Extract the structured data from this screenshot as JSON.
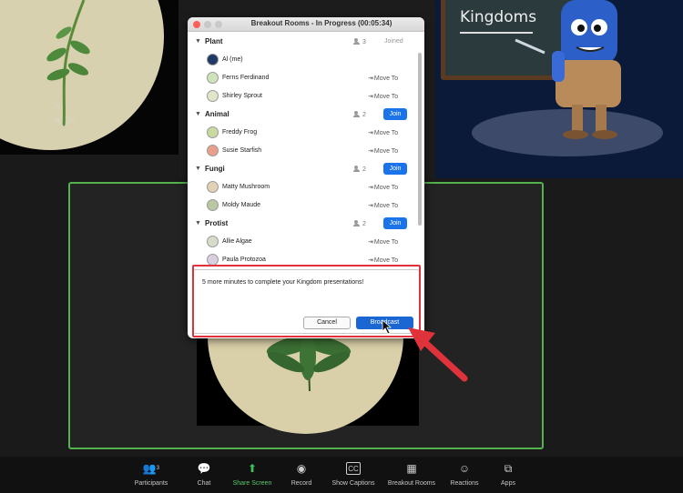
{
  "window": {
    "title": "Breakout Rooms - In Progress (00:05:34)"
  },
  "rooms": [
    {
      "name": "Plant",
      "count": "3",
      "status": "Joined",
      "members": [
        {
          "name": "Al (me)",
          "move_to": ""
        },
        {
          "name": "Ferns Ferdinand",
          "move_to": "Move To"
        },
        {
          "name": "Shirley Sprout",
          "move_to": "Move To"
        }
      ]
    },
    {
      "name": "Animal",
      "count": "2",
      "action": "Join",
      "members": [
        {
          "name": "Freddy Frog",
          "move_to": "Move To"
        },
        {
          "name": "Susie Starfish",
          "move_to": "Move To"
        }
      ]
    },
    {
      "name": "Fungi",
      "count": "2",
      "action": "Join",
      "members": [
        {
          "name": "Matty Mushroom",
          "move_to": "Move To"
        },
        {
          "name": "Moldy Maude",
          "move_to": "Move To"
        }
      ]
    },
    {
      "name": "Protist",
      "count": "2",
      "action": "Join",
      "members": [
        {
          "name": "Allie Algae",
          "move_to": "Move To"
        },
        {
          "name": "Paula Protozoa",
          "move_to": "Move To"
        }
      ]
    }
  ],
  "broadcast": {
    "message": "5 more minutes to complete your Kingdom presentations!",
    "cancel_label": "Cancel",
    "broadcast_label": "Broadcast"
  },
  "video": {
    "board_text": "Kingdoms"
  },
  "toolbar": {
    "participants_label": "Participants",
    "participants_count": "3",
    "chat_label": "Chat",
    "share_label": "Share Screen",
    "record_label": "Record",
    "captions_label": "Show Captions",
    "breakout_label": "Breakout Rooms",
    "reactions_label": "Reactions",
    "apps_label": "Apps"
  },
  "colors": {
    "join_button": "#1a73e8",
    "broadcast_button": "#1a66d2",
    "highlight": "#e0323a",
    "active_speaker_border": "#55b04e",
    "share_green": "#3ec05a"
  }
}
